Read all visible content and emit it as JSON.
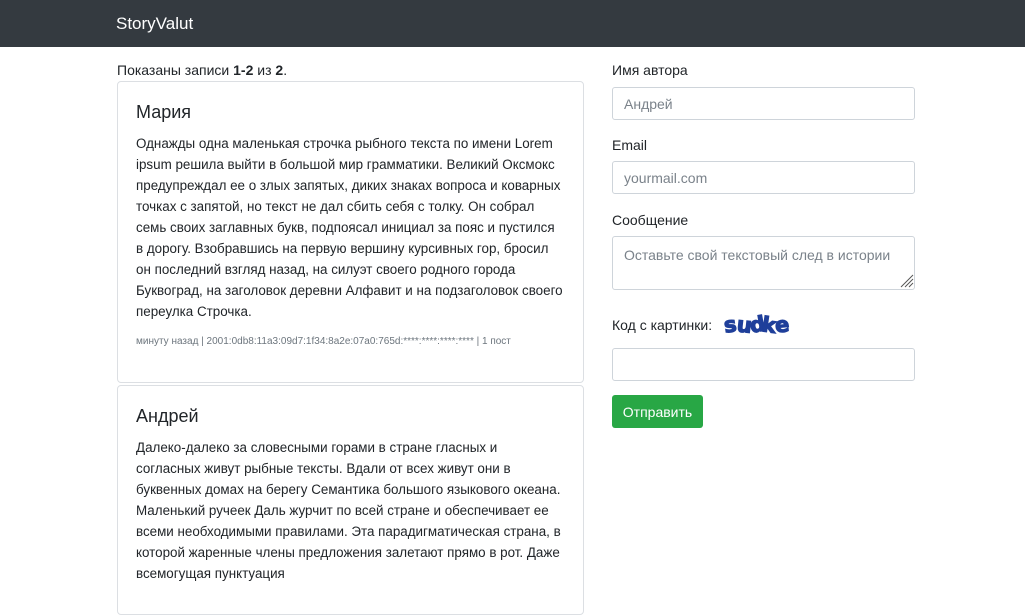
{
  "app": {
    "brand": "StoryValut"
  },
  "summary": {
    "prefix": "Показаны записи ",
    "range": "1-2",
    "middle": " из ",
    "total": "2",
    "suffix": "."
  },
  "posts": [
    {
      "author": "Мария",
      "text": "Однажды одна маленькая строчка рыбного текста по имени Lorem ipsum решила выйти в большой мир грамматики. Великий Оксмокс предупреждал ее о злых запятых, диких знаках вопроса и коварных точках с запятой, но текст не дал сбить себя с толку. Он собрал семь своих заглавных букв, подпоясал инициал за пояс и пустился в дорогу. Взобравшись на первую вершину курсивных гор, бросил он последний взгляд назад, на силуэт своего родного города Буквоград, на заголовок деревни Алфавит и на подзаголовок своего переулка Строчка.",
      "meta": "минуту назад | 2001:0db8:11a3:09d7:1f34:8a2e:07a0:765d:****:****:****:**** | 1 пост"
    },
    {
      "author": "Андрей",
      "text": "Далеко-далеко за словесными горами в стране гласных и согласных живут рыбные тексты. Вдали от всех живут они в буквенных домах на берегу Семантика большого языкового океана. Маленький ручеек Даль журчит по всей стране и обеспечивает ее всеми необходимыми правилами. Эта парадигматическая страна, в которой жаренные члены предложения залетают прямо в рот. Даже всемогущая пунктуация"
    }
  ],
  "form": {
    "author_label": "Имя автора",
    "author_placeholder": "Андрей",
    "author_value": "",
    "email_label": "Email",
    "email_placeholder": "yourmail.com",
    "email_value": "",
    "message_label": "Сообщение",
    "message_placeholder": "Оставьте свой текстовый след в истории",
    "message_value": "",
    "captcha_label": "Код с картинки:",
    "captcha_text": "sudke",
    "captcha_color": "#1f3f9a",
    "captcha_value": "",
    "submit_label": "Отправить"
  },
  "colors": {
    "navbar": "#343a40",
    "submit": "#28a745"
  }
}
